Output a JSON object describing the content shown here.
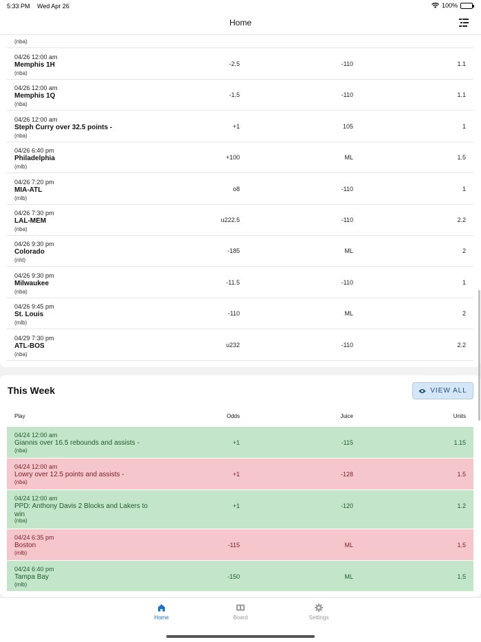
{
  "status_bar": {
    "time": "5:33 PM",
    "date": "Wed Apr 26",
    "battery": "100%"
  },
  "nav": {
    "title": "Home",
    "menu_icon": "list-filter-icon"
  },
  "upcoming": {
    "partial_league": "(nba)",
    "rows": [
      {
        "date": "04/26 12:00 am",
        "team": "Memphis 1H",
        "league": "(nba)",
        "odds": "-2.5",
        "juice": "-110",
        "units": "1.1"
      },
      {
        "date": "04/26 12:00 am",
        "team": "Memphis 1Q",
        "league": "(nba)",
        "odds": "-1.5",
        "juice": "-110",
        "units": "1.1"
      },
      {
        "date": "04/26 12:00 am",
        "team": "Steph Curry over 32.5 points -",
        "league": "(nba)",
        "odds": "+1",
        "juice": "105",
        "units": "1"
      },
      {
        "date": "04/26 6:40 pm",
        "team": "Philadelphia",
        "league": "(mlb)",
        "odds": "+100",
        "juice": "ML",
        "units": "1.5"
      },
      {
        "date": "04/26 7:20 pm",
        "team": "MIA-ATL",
        "league": "(mlb)",
        "odds": "o8",
        "juice": "-110",
        "units": "1"
      },
      {
        "date": "04/26 7:30 pm",
        "team": "LAL-MEM",
        "league": "(nba)",
        "odds": "u222.5",
        "juice": "-110",
        "units": "2.2"
      },
      {
        "date": "04/26 9:30 pm",
        "team": "Colorado",
        "league": "(nhl)",
        "odds": "-185",
        "juice": "ML",
        "units": "2"
      },
      {
        "date": "04/26 9:30 pm",
        "team": "Milwaukee",
        "league": "(nba)",
        "odds": "-11.5",
        "juice": "-110",
        "units": "1"
      },
      {
        "date": "04/26 9:45 pm",
        "team": "St. Louis",
        "league": "(mlb)",
        "odds": "-110",
        "juice": "ML",
        "units": "2"
      },
      {
        "date": "04/29 7:30 pm",
        "team": "ATL-BOS",
        "league": "(nba)",
        "odds": "u232",
        "juice": "-110",
        "units": "2.2"
      }
    ]
  },
  "this_week": {
    "title": "This Week",
    "view_all_label": "VIEW ALL",
    "headers": {
      "play": "Play",
      "odds": "Odds",
      "juice": "Juice",
      "units": "Units"
    },
    "rows": [
      {
        "date": "04/24 12:00 am",
        "play": "Giannis over 16.5 rebounds and assists -",
        "league": "(nba)",
        "odds": "+1",
        "juice": "-115",
        "units": "1.15",
        "result": "win"
      },
      {
        "date": "04/24 12:00 am",
        "play": "Lowry over 12.5 points and assists -",
        "league": "(nba)",
        "odds": "+1",
        "juice": "-128",
        "units": "1.5",
        "result": "loss"
      },
      {
        "date": "04/24 12:00 am",
        "play": "PPD: Anthony Davis 2 Blocks and Lakers to win",
        "league": "(nba)",
        "odds": "+1",
        "juice": "-120",
        "units": "1.2",
        "result": "win"
      },
      {
        "date": "04/24 6:35 pm",
        "play": "Boston",
        "league": "(mlb)",
        "odds": "-115",
        "juice": "ML",
        "units": "1.5",
        "result": "loss"
      },
      {
        "date": "04/24 6:40 pm",
        "play": "Tampa Bay",
        "league": "(mlb)",
        "odds": "-150",
        "juice": "ML",
        "units": "1.5",
        "result": "win"
      }
    ]
  },
  "tabs": [
    {
      "label": "Home",
      "icon": "home-icon",
      "active": true
    },
    {
      "label": "Board",
      "icon": "scoreboard-icon",
      "active": false
    },
    {
      "label": "Settings",
      "icon": "gear-icon",
      "active": false
    }
  ],
  "colors": {
    "accent": "#1a73c4",
    "win_bg": "#c3e6cb",
    "loss_bg": "#f5c6cb"
  }
}
